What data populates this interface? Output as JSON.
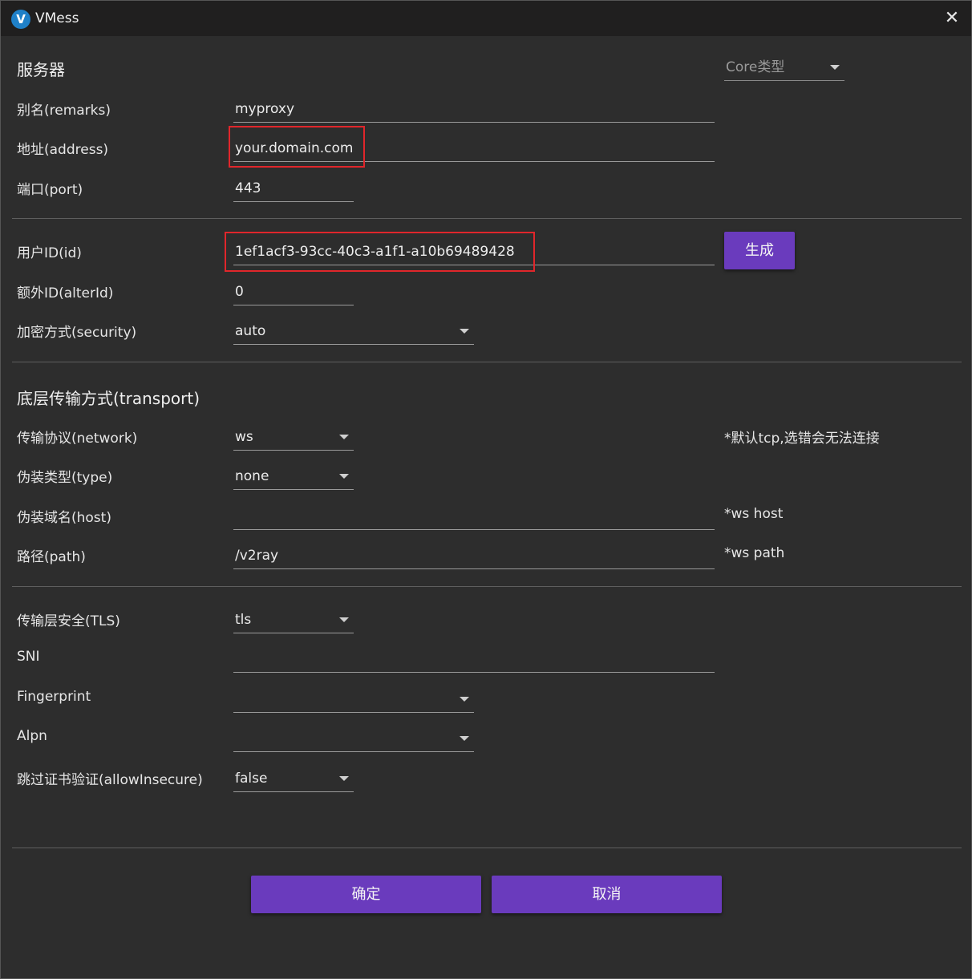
{
  "window": {
    "title": "VMess",
    "logo_letter": "V",
    "close_glyph": "✕"
  },
  "server": {
    "section_title": "服务器",
    "core_type": {
      "placeholder": "Core类型",
      "value": ""
    },
    "remarks": {
      "label": "别名(remarks)",
      "value": "myproxy"
    },
    "address": {
      "label": "地址(address)",
      "value": "your.domain.com"
    },
    "port": {
      "label": "端口(port)",
      "value": "443"
    }
  },
  "user": {
    "id": {
      "label": "用户ID(id)",
      "value": "1ef1acf3-93cc-40c3-a1f1-a10b69489428"
    },
    "generate_button": "生成",
    "alter_id": {
      "label": "额外ID(alterId)",
      "value": "0"
    },
    "security": {
      "label": "加密方式(security)",
      "value": "auto"
    }
  },
  "transport": {
    "section_title": "底层传输方式(transport)",
    "network": {
      "label": "传输协议(network)",
      "value": "ws",
      "hint": "*默认tcp,选错会无法连接"
    },
    "type": {
      "label": "伪装类型(type)",
      "value": "none"
    },
    "host": {
      "label": "伪装域名(host)",
      "value": "",
      "hint": "*ws host"
    },
    "path": {
      "label": "路径(path)",
      "value": "/v2ray",
      "hint": "*ws path"
    }
  },
  "tls": {
    "security": {
      "label": "传输层安全(TLS)",
      "value": "tls"
    },
    "sni": {
      "label": "SNI",
      "value": ""
    },
    "fingerprint": {
      "label": "Fingerprint",
      "value": ""
    },
    "alpn": {
      "label": "Alpn",
      "value": ""
    },
    "allow_insecure": {
      "label": "跳过证书验证(allowInsecure)",
      "value": "false"
    }
  },
  "footer": {
    "ok_button": "确定",
    "cancel_button": "取消"
  },
  "colors": {
    "accent": "#6a3bbd",
    "highlight": "#e0262b",
    "background": "#2d2d2d",
    "titlebar": "#201f1f"
  }
}
